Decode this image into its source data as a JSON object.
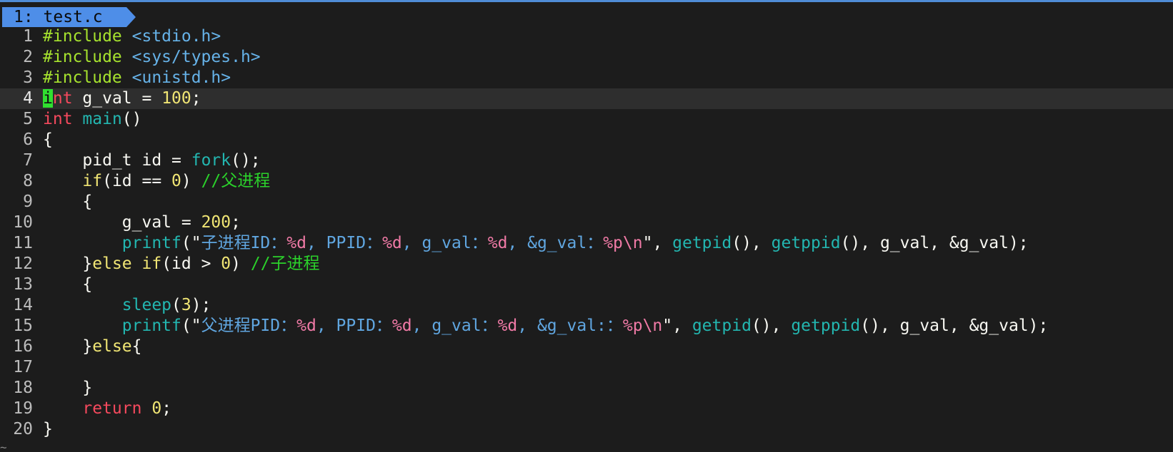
{
  "tab": {
    "label": "1: test.c"
  },
  "current_line_index": 3,
  "lines": [
    {
      "n": "1",
      "tokens": [
        {
          "t": "#include ",
          "c": "pre"
        },
        {
          "t": "<stdio.h>",
          "c": "inc"
        }
      ]
    },
    {
      "n": "2",
      "tokens": [
        {
          "t": "#include ",
          "c": "pre"
        },
        {
          "t": "<sys/types.h>",
          "c": "inc"
        }
      ]
    },
    {
      "n": "3",
      "tokens": [
        {
          "t": "#include ",
          "c": "pre"
        },
        {
          "t": "<unistd.h>",
          "c": "inc"
        }
      ]
    },
    {
      "n": "4",
      "tokens": [
        {
          "t": "i",
          "c": "cursor"
        },
        {
          "t": "nt",
          "c": "type"
        },
        {
          "t": " g_val = ",
          "c": "plain"
        },
        {
          "t": "100",
          "c": "num"
        },
        {
          "t": ";",
          "c": "plain"
        }
      ]
    },
    {
      "n": "5",
      "tokens": [
        {
          "t": "int",
          "c": "type"
        },
        {
          "t": " ",
          "c": "plain"
        },
        {
          "t": "main",
          "c": "fn"
        },
        {
          "t": "()",
          "c": "plain"
        }
      ]
    },
    {
      "n": "6",
      "tokens": [
        {
          "t": "{",
          "c": "plain"
        }
      ]
    },
    {
      "n": "7",
      "tokens": [
        {
          "t": "    pid_t id = ",
          "c": "plain"
        },
        {
          "t": "fork",
          "c": "fn"
        },
        {
          "t": "();",
          "c": "plain"
        }
      ]
    },
    {
      "n": "8",
      "tokens": [
        {
          "t": "    ",
          "c": "plain"
        },
        {
          "t": "if",
          "c": "kw"
        },
        {
          "t": "(id == ",
          "c": "plain"
        },
        {
          "t": "0",
          "c": "num"
        },
        {
          "t": ") ",
          "c": "plain"
        },
        {
          "t": "//父进程",
          "c": "cmt"
        }
      ]
    },
    {
      "n": "9",
      "tokens": [
        {
          "t": "    {",
          "c": "plain"
        }
      ]
    },
    {
      "n": "10",
      "tokens": [
        {
          "t": "        g_val = ",
          "c": "plain"
        },
        {
          "t": "200",
          "c": "num"
        },
        {
          "t": ";",
          "c": "plain"
        }
      ]
    },
    {
      "n": "11",
      "tokens": [
        {
          "t": "        ",
          "c": "plain"
        },
        {
          "t": "printf",
          "c": "fn"
        },
        {
          "t": "(\"",
          "c": "plain"
        },
        {
          "t": "子进程ID：",
          "c": "str"
        },
        {
          "t": "%d",
          "c": "fmt"
        },
        {
          "t": ", PPID：",
          "c": "str"
        },
        {
          "t": "%d",
          "c": "fmt"
        },
        {
          "t": ", g_val：",
          "c": "str"
        },
        {
          "t": "%d",
          "c": "fmt"
        },
        {
          "t": ", &g_val：",
          "c": "str"
        },
        {
          "t": "%p\\n",
          "c": "fmt"
        },
        {
          "t": "\", ",
          "c": "plain"
        },
        {
          "t": "getpid",
          "c": "fn"
        },
        {
          "t": "(), ",
          "c": "plain"
        },
        {
          "t": "getppid",
          "c": "fn"
        },
        {
          "t": "(), g_val, &g_val);",
          "c": "plain"
        }
      ]
    },
    {
      "n": "12",
      "tokens": [
        {
          "t": "    }",
          "c": "plain"
        },
        {
          "t": "else if",
          "c": "kw"
        },
        {
          "t": "(id > ",
          "c": "plain"
        },
        {
          "t": "0",
          "c": "num"
        },
        {
          "t": ") ",
          "c": "plain"
        },
        {
          "t": "//子进程",
          "c": "cmt"
        }
      ]
    },
    {
      "n": "13",
      "tokens": [
        {
          "t": "    {",
          "c": "plain"
        }
      ]
    },
    {
      "n": "14",
      "tokens": [
        {
          "t": "        ",
          "c": "plain"
        },
        {
          "t": "sleep",
          "c": "fn"
        },
        {
          "t": "(",
          "c": "plain"
        },
        {
          "t": "3",
          "c": "num"
        },
        {
          "t": ");",
          "c": "plain"
        }
      ]
    },
    {
      "n": "15",
      "tokens": [
        {
          "t": "        ",
          "c": "plain"
        },
        {
          "t": "printf",
          "c": "fn"
        },
        {
          "t": "(\"",
          "c": "plain"
        },
        {
          "t": "父进程PID：",
          "c": "str"
        },
        {
          "t": "%d",
          "c": "fmt"
        },
        {
          "t": ", PPID：",
          "c": "str"
        },
        {
          "t": "%d",
          "c": "fmt"
        },
        {
          "t": ", g_val：",
          "c": "str"
        },
        {
          "t": "%d",
          "c": "fmt"
        },
        {
          "t": ", &g_val:：",
          "c": "str"
        },
        {
          "t": "%p\\n",
          "c": "fmt"
        },
        {
          "t": "\", ",
          "c": "plain"
        },
        {
          "t": "getpid",
          "c": "fn"
        },
        {
          "t": "(), ",
          "c": "plain"
        },
        {
          "t": "getppid",
          "c": "fn"
        },
        {
          "t": "(), g_val, &g_val);",
          "c": "plain"
        }
      ]
    },
    {
      "n": "16",
      "tokens": [
        {
          "t": "    }",
          "c": "plain"
        },
        {
          "t": "else",
          "c": "kw"
        },
        {
          "t": "{",
          "c": "plain"
        }
      ]
    },
    {
      "n": "17",
      "tokens": [
        {
          "t": "",
          "c": "plain"
        }
      ]
    },
    {
      "n": "18",
      "tokens": [
        {
          "t": "    }",
          "c": "plain"
        }
      ]
    },
    {
      "n": "19",
      "tokens": [
        {
          "t": "    ",
          "c": "plain"
        },
        {
          "t": "return",
          "c": "ret"
        },
        {
          "t": " ",
          "c": "plain"
        },
        {
          "t": "0",
          "c": "num"
        },
        {
          "t": ";",
          "c": "plain"
        }
      ]
    },
    {
      "n": "20",
      "tokens": [
        {
          "t": "}",
          "c": "plain"
        }
      ]
    }
  ],
  "end_of_buffer_marker": "~"
}
